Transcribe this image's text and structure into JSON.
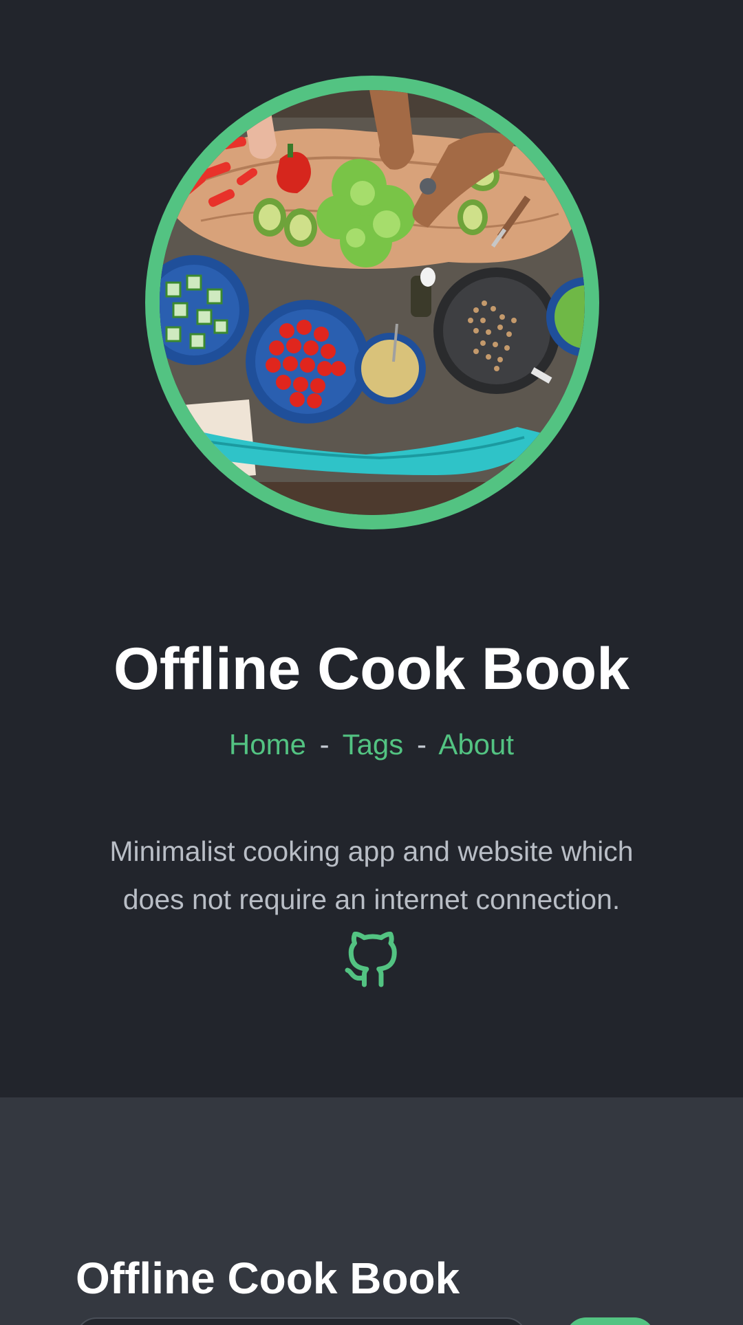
{
  "hero": {
    "image_alt": "Overhead view of hands chopping vegetables on a rustic wooden table",
    "title": "Offline Cook Book",
    "nav": {
      "home": "Home",
      "separator1": "-",
      "tags": "Tags",
      "separator2": "-",
      "about": "About"
    },
    "description": "Minimalist cooking app and website which does not require an internet connection.",
    "github_icon": "github-icon"
  },
  "lower": {
    "title": "Offline Cook Book"
  },
  "colors": {
    "background": "#22252c",
    "accent": "#53c382",
    "section_background": "#343840",
    "text_primary": "#ffffff",
    "text_muted": "#b9bec6"
  }
}
